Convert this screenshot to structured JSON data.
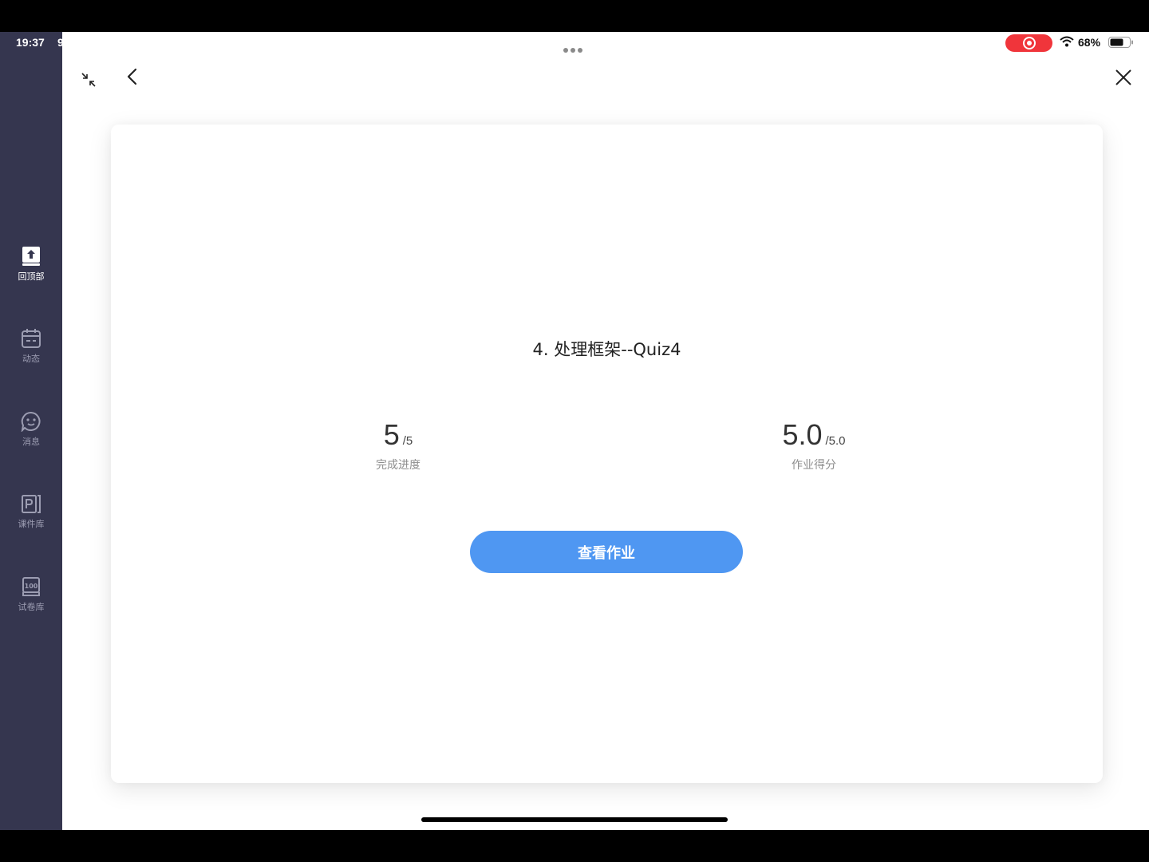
{
  "status_bar": {
    "time": "19:37",
    "time_extra": "9",
    "battery_percent": "68%"
  },
  "sidebar": {
    "items": [
      {
        "label": "回顶部",
        "icon": "upload-to-top-icon",
        "active": true
      },
      {
        "label": "动态",
        "icon": "calendar-icon",
        "active": false
      },
      {
        "label": "消息",
        "icon": "chat-bubble-icon",
        "active": false
      },
      {
        "label": "课件库",
        "icon": "ppt-file-icon",
        "active": false
      },
      {
        "label": "试卷库",
        "icon": "exam-paper-icon",
        "active": false
      }
    ]
  },
  "toolbar": {
    "icons": [
      "collapse-icon",
      "back-icon",
      "close-icon"
    ]
  },
  "card": {
    "title": "4. 处理框架--Quiz4",
    "progress": {
      "value": "5",
      "total": "/5",
      "label": "完成进度"
    },
    "score": {
      "value": "5.0",
      "total": "/5.0",
      "label": "作业得分"
    },
    "view_button_label": "查看作业"
  },
  "colors": {
    "sidebar_bg": "#35364f",
    "accent_button": "#4f97f2",
    "record_indicator": "#f0353b"
  }
}
